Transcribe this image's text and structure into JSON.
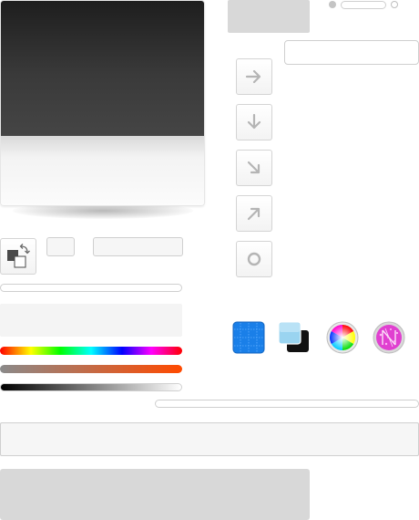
{
  "editor": {
    "stops_control": {
      "left_dot": "filled",
      "right_dot": "hollow"
    },
    "direction_buttons": [
      {
        "name": "right-arrow-icon",
        "direction": "right"
      },
      {
        "name": "down-arrow-icon",
        "direction": "down"
      },
      {
        "name": "down-right-arrow-icon",
        "direction": "down-right"
      },
      {
        "name": "up-right-arrow-icon",
        "direction": "up-right"
      },
      {
        "name": "radial-icon",
        "direction": "radial"
      }
    ],
    "color_inputs": {
      "hex_value": "",
      "stop_value": ""
    },
    "sliders": [
      {
        "name": "hue-slider",
        "colors": [
          "#ff0000",
          "#ffff00",
          "#00ff00",
          "#00ffff",
          "#0000ff",
          "#ff00ff",
          "#ff0000"
        ]
      },
      {
        "name": "saturation-slider",
        "colors": [
          "#8a8a8a",
          "#ff4a00"
        ]
      },
      {
        "name": "brightness-slider",
        "colors": [
          "#000000",
          "#ffffff"
        ]
      }
    ],
    "tools": [
      {
        "name": "grid-texture-icon",
        "color": "#1a7fe8"
      },
      {
        "name": "layers-icon",
        "color": "#8fd0f0"
      },
      {
        "name": "color-wheel-icon",
        "color": "#ff0000"
      },
      {
        "name": "noise-texture-icon",
        "color": "#e040d0"
      }
    ]
  }
}
